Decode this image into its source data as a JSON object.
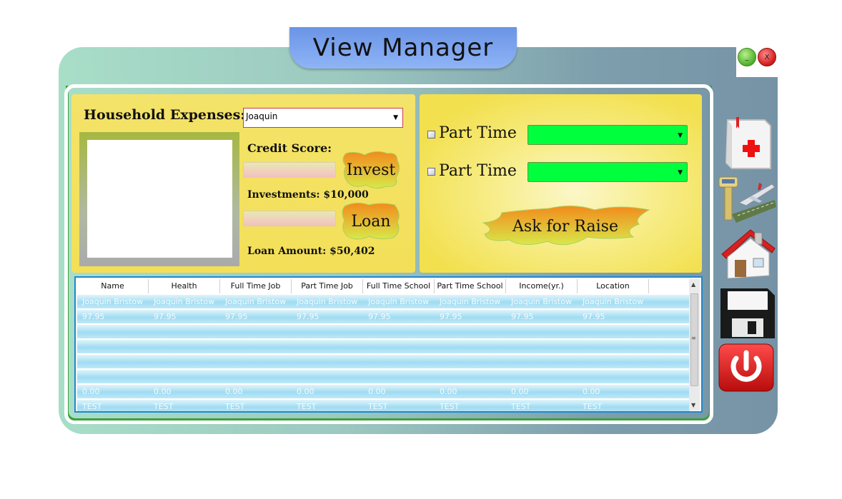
{
  "window": {
    "title": "View Manager",
    "minimize_label": "_",
    "close_label": "X"
  },
  "left_panel": {
    "household_label": "Household Expenses:",
    "person_select_value": "Joaquin",
    "credit_label": "Credit Score:",
    "investments_label": "Investments: $10,000",
    "loan_amount_label": "Loan Amount: $50,402",
    "invest_button": "Invest",
    "loan_button": "Loan"
  },
  "right_panel": {
    "part_time_1_label": "Part Time",
    "part_time_2_label": "Part Time",
    "part_time_1_value": "",
    "part_time_2_value": "",
    "raise_button": "Ask for Raise"
  },
  "grid": {
    "columns": [
      "Name",
      "Health",
      "Full Time Job",
      "Part Time Job",
      "Full Time School",
      "Part Time School",
      "Income(yr.)",
      "Location"
    ],
    "rows": [
      [
        "Joaquin Bristow",
        "Joaquin Bristow",
        "Joaquin Bristow",
        "Joaquin Bristow",
        "Joaquin Bristow",
        "Joaquin Bristow",
        "Joaquin Bristow",
        "Joaquin Bristow"
      ],
      [
        "97.95",
        "97.95",
        "97.95",
        "97.95",
        "97.95",
        "97.95",
        "97.95",
        "97.95"
      ],
      [
        "",
        "",
        "",
        "",
        "",
        "",
        "",
        ""
      ],
      [
        "",
        "",
        "",
        "",
        "",
        "",
        "",
        ""
      ],
      [
        "",
        "",
        "",
        "",
        "",
        "",
        "",
        ""
      ],
      [
        "",
        "",
        "",
        "",
        "",
        "",
        "",
        ""
      ],
      [
        "0.00",
        "0.00",
        "0.00",
        "0.00",
        "0.00",
        "0.00",
        "0.00",
        "0.00"
      ],
      [
        "TEST",
        "TEST",
        "TEST",
        "TEST",
        "TEST",
        "TEST",
        "TEST",
        "TEST"
      ]
    ]
  },
  "sidebar": {
    "icons": [
      "health-book-icon",
      "airport-travel-icon",
      "house-icon",
      "save-floppy-icon",
      "power-icon"
    ]
  },
  "colors": {
    "panel_yellow": "#f3df58",
    "select_green": "#00ff3c",
    "grid_border": "#1e88d0",
    "title_pill": "#7aa2ec"
  }
}
